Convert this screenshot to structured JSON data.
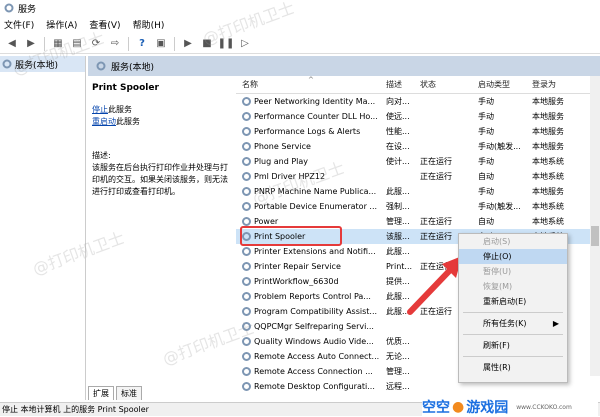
{
  "window": {
    "title": "服务"
  },
  "menubar": [
    "文件(F)",
    "操作(A)",
    "查看(V)",
    "帮助(H)"
  ],
  "tree": {
    "root": "服务(本地)"
  },
  "panel": {
    "title": "服务(本地)"
  },
  "description": {
    "service_name": "Print Spooler",
    "stop_link": "停止",
    "stop_suffix": "此服务",
    "restart_link": "重启动",
    "restart_suffix": "此服务",
    "desc_label": "描述:",
    "desc_text": "该服务在后台执行打印作业并处理与打印机的交互。如果关闭该服务，则无法进行打印或查看打印机。"
  },
  "table": {
    "headers": {
      "name": "名称",
      "desc": "描述",
      "status": "状态",
      "type": "启动类型",
      "logon": "登录为"
    },
    "rows": [
      {
        "name": "Peer Networking Identity Ma...",
        "desc": "向对...",
        "status": "",
        "type": "手动",
        "logon": "本地服务"
      },
      {
        "name": "Performance Counter DLL Ho...",
        "desc": "使远...",
        "status": "",
        "type": "手动",
        "logon": "本地服务"
      },
      {
        "name": "Performance Logs & Alerts",
        "desc": "性能...",
        "status": "",
        "type": "手动",
        "logon": "本地服务"
      },
      {
        "name": "Phone Service",
        "desc": "在设...",
        "status": "",
        "type": "手动(触发...",
        "logon": "本地服务"
      },
      {
        "name": "Plug and Play",
        "desc": "使计...",
        "status": "正在运行",
        "type": "手动",
        "logon": "本地系统"
      },
      {
        "name": "Pml Driver HPZ12",
        "desc": "",
        "status": "正在运行",
        "type": "自动",
        "logon": "本地系统"
      },
      {
        "name": "PNRP Machine Name Publica...",
        "desc": "此服...",
        "status": "",
        "type": "手动",
        "logon": "本地服务"
      },
      {
        "name": "Portable Device Enumerator ...",
        "desc": "强制...",
        "status": "",
        "type": "手动(触发...",
        "logon": "本地系统"
      },
      {
        "name": "Power",
        "desc": "管理...",
        "status": "正在运行",
        "type": "自动",
        "logon": "本地系统"
      },
      {
        "name": "Print Spooler",
        "desc": "该服...",
        "status": "正在运行",
        "type": "自动",
        "logon": "本地系统"
      },
      {
        "name": "Printer Extensions and Notifi...",
        "desc": "此服...",
        "status": "",
        "type": "",
        "logon": ""
      },
      {
        "name": "Printer Repair Service",
        "desc": "Print...",
        "status": "正在运行",
        "type": "",
        "logon": ""
      },
      {
        "name": "PrintWorkflow_6630d",
        "desc": "提供...",
        "status": "",
        "type": "",
        "logon": ""
      },
      {
        "name": "Problem Reports Control Pa...",
        "desc": "此服...",
        "status": "",
        "type": "",
        "logon": ""
      },
      {
        "name": "Program Compatibility Assist...",
        "desc": "此服...",
        "status": "正在运行",
        "type": "",
        "logon": ""
      },
      {
        "name": "QQPCMgr Selfreparing Servi...",
        "desc": "",
        "status": "",
        "type": "",
        "logon": ""
      },
      {
        "name": "Quality Windows Audio Vide...",
        "desc": "优质...",
        "status": "",
        "type": "",
        "logon": ""
      },
      {
        "name": "Remote Access Auto Connect...",
        "desc": "无论...",
        "status": "",
        "type": "",
        "logon": ""
      },
      {
        "name": "Remote Access Connection ...",
        "desc": "管理...",
        "status": "",
        "type": "",
        "logon": ""
      },
      {
        "name": "Remote Desktop Configurati...",
        "desc": "远程...",
        "status": "",
        "type": "",
        "logon": ""
      }
    ]
  },
  "context_menu": {
    "items": [
      {
        "label": "启动(S)",
        "disabled": true
      },
      {
        "label": "停止(O)",
        "disabled": false,
        "hover": true
      },
      {
        "label": "暂停(U)",
        "disabled": true
      },
      {
        "label": "恢复(M)",
        "disabled": true
      },
      {
        "label": "重新启动(E)",
        "disabled": false
      },
      {
        "label": "所有任务(K)",
        "disabled": false,
        "submenu": true
      },
      {
        "label": "刷新(F)",
        "disabled": false
      },
      {
        "label": "属性(R)",
        "disabled": false
      }
    ]
  },
  "tabs": [
    "扩展",
    "标准"
  ],
  "statusbar": "停止 本地计算机 上的服务 Print Spooler",
  "logo": {
    "text1": "空空",
    "text2": "游戏园",
    "url": "www.CCKOKO.com"
  },
  "watermark": "@打印机卫士",
  "colors": {
    "highlight": "#e53a3a",
    "selection": "#cde3f7",
    "logo_blue": "#1b6fe0",
    "logo_orange": "#f28a1e"
  }
}
